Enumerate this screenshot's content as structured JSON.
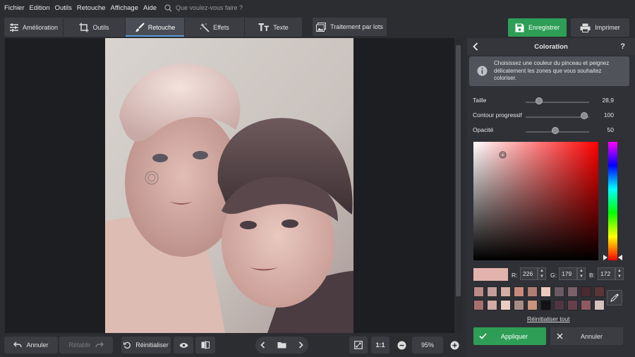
{
  "menu": [
    "Fichier",
    "Edition",
    "Outils",
    "Retouche",
    "Affichage",
    "Aide"
  ],
  "search": {
    "placeholder": "Que voulez-vous faire ?"
  },
  "tabs": [
    {
      "label": "Amélioration",
      "icon": "sliders-icon",
      "active": false
    },
    {
      "label": "Outils",
      "icon": "crop-icon",
      "active": false
    },
    {
      "label": "Retouche",
      "icon": "brush-icon",
      "active": true
    },
    {
      "label": "Effets",
      "icon": "magic-wand-icon",
      "active": false
    },
    {
      "label": "Texte",
      "icon": "text-icon",
      "active": false
    }
  ],
  "toolbar": {
    "batch_label": "Traitement par lots",
    "save_label": "Enregistrer",
    "print_label": "Imprimer"
  },
  "panel": {
    "title": "Coloration",
    "help": "?",
    "info_text": "Choisissez une couleur du pinceau et peignez délicatement les zones que vous souhaitez coloriser.",
    "sliders": [
      {
        "label": "Taille",
        "value": "28,9",
        "level": 0.18
      },
      {
        "label": "Contour progressif",
        "value": "100",
        "level": 1.0
      },
      {
        "label": "Opacité",
        "value": "50",
        "level": 0.5
      }
    ],
    "color": {
      "current": "#e2b3ac",
      "r_label": "R:",
      "r": "226",
      "g_label": "G:",
      "g": "179",
      "b_label": "B:",
      "b": "172"
    },
    "swatches_row1": [
      "#b98a88",
      "#c29d9a",
      "#d6aea6",
      "#c88a7e",
      "#b07e74",
      "#eccbbf",
      "#6a5b62",
      "#7b6169",
      "#4a2a31",
      "#5c3538"
    ],
    "swatches_row2": [
      "#a77070",
      "#d2aca5",
      "#e9cdc6",
      "#a78c85",
      "#c9937e",
      "#131214",
      "#4d3640",
      "#65404a",
      "#8e5a62",
      "#d6c1bf"
    ],
    "reset_all": "Réinitialiser tout",
    "apply": "Appliquer",
    "cancel": "Annuler"
  },
  "bottom": {
    "undo": "Annuler",
    "redo": "Rétablir",
    "reset": "Réinitialiser",
    "ratio": "1:1",
    "zoom": "95%"
  },
  "colors": {
    "accent": "#2e9e57",
    "background": "#2b2d31"
  }
}
